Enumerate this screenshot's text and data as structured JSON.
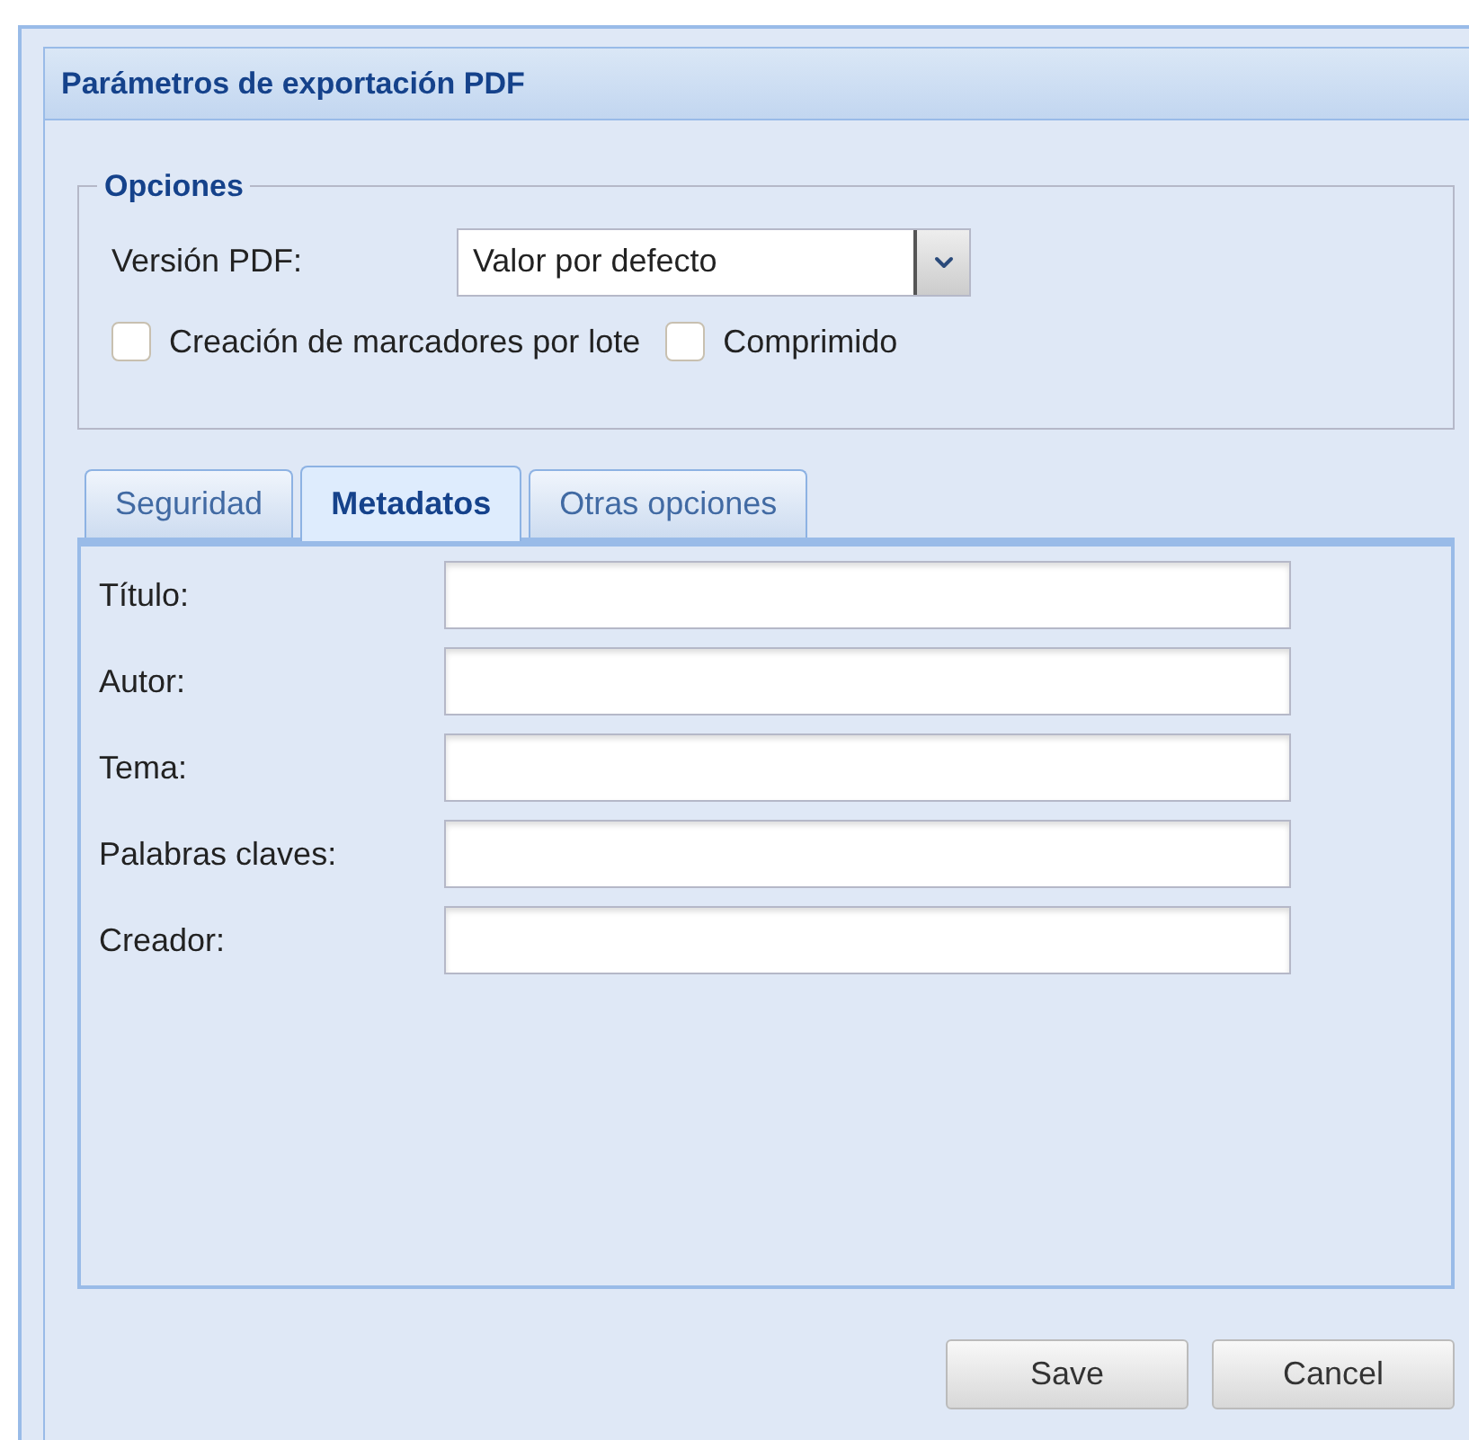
{
  "window": {
    "title": "Parámetros de exportación PDF"
  },
  "options": {
    "legend": "Opciones",
    "version_label": "Versión PDF:",
    "version_value": "Valor por defecto",
    "checkboxes": [
      {
        "label": "Creación de marcadores por lote",
        "checked": false
      },
      {
        "label": "Comprimido",
        "checked": false
      }
    ]
  },
  "tabs": [
    {
      "label": "Seguridad",
      "selected": false
    },
    {
      "label": "Metadatos",
      "selected": true
    },
    {
      "label": "Otras opciones",
      "selected": false
    }
  ],
  "fields": [
    {
      "label": "Título:"
    },
    {
      "label": "Autor:"
    },
    {
      "label": "Tema:"
    },
    {
      "label": "Palabras claves:"
    },
    {
      "label": "Creador:"
    }
  ],
  "buttons": [
    "Save",
    "Cancel"
  ]
}
